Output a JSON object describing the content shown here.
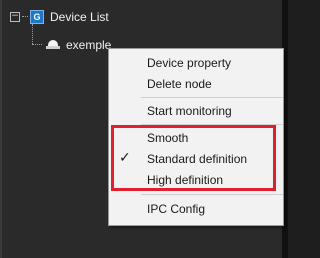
{
  "tree": {
    "root_label": "Device List",
    "root_icon": "device-list-icon",
    "collapse_symbol": "−",
    "root_icon_letter": "G",
    "child_label": "exemple",
    "child_icon": "dome-camera-icon"
  },
  "context_menu": {
    "items": [
      {
        "label": "Device property",
        "checked": false
      },
      {
        "label": "Delete node",
        "checked": false
      },
      {
        "label": "Start monitoring",
        "checked": false
      },
      {
        "label": "Smooth",
        "checked": false
      },
      {
        "label": "Standard definition",
        "checked": true
      },
      {
        "label": "High definition",
        "checked": false
      },
      {
        "label": "IPC Config",
        "checked": false
      }
    ],
    "check_mark": "✓"
  },
  "colors": {
    "highlight": "#e0202c",
    "panel_bg": "#2a2a2a",
    "menu_bg": "#f2f2f2"
  }
}
